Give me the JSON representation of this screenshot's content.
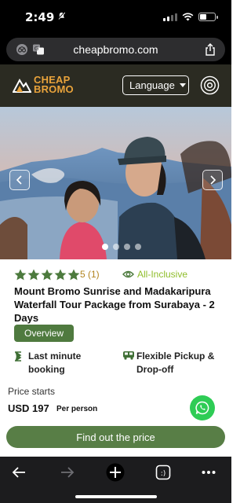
{
  "status_bar": {
    "time": "2:49"
  },
  "browser": {
    "url": "cheapbromo.com"
  },
  "header": {
    "logo_line1": "CHEAP",
    "logo_line2": "BROMO",
    "language_label": "Language"
  },
  "hero": {
    "slide_count": 4,
    "active_slide": 1
  },
  "tour": {
    "rating_text": "5 (1)",
    "star_count": 5,
    "inclusion_label": "All-Inclusive",
    "title": "Mount Bromo Sunrise and Madakaripura Waterfall Tour Package from Surabaya - 2 Days",
    "overview_label": "Overview",
    "features": {
      "booking": "Last minute booking",
      "pickup": "Flexible Pickup & Drop-off"
    },
    "price_label": "Price starts",
    "price_value": "USD 197",
    "price_unit": "Per person",
    "cta_label": "Find out the price"
  },
  "colors": {
    "header_bg": "#2b2b22",
    "brand_orange": "#e9a33b",
    "star_green": "#4c7a3d",
    "cta_green": "#587e46",
    "whatsapp_green": "#2ecc55"
  }
}
